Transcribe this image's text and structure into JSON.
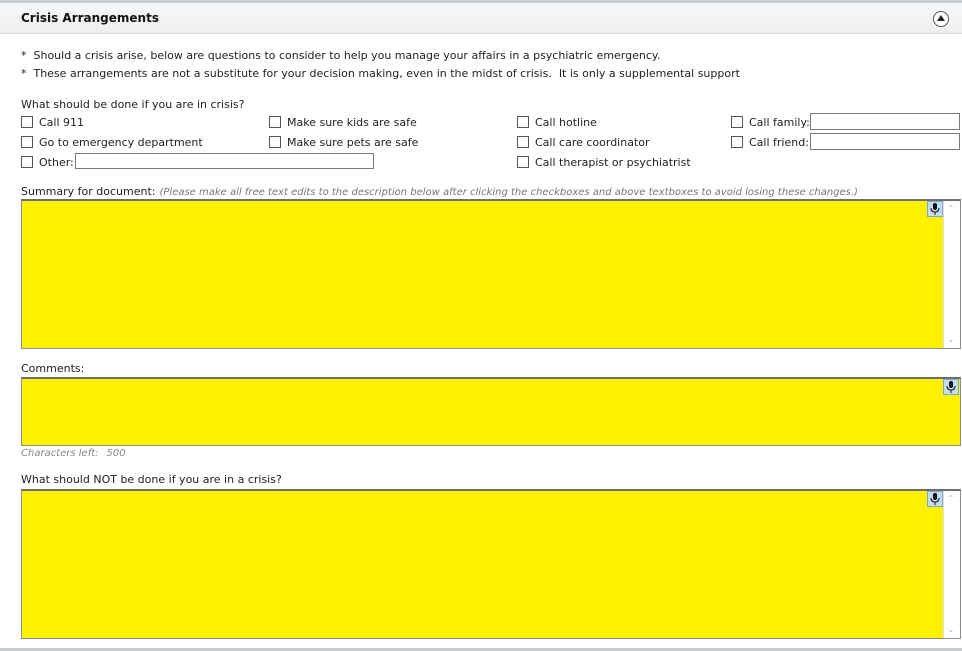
{
  "panel": {
    "title": "Crisis Arrangements"
  },
  "notes": [
    "*  Should a crisis arise, below are questions to consider to help you manage your affairs in a psychiatric emergency.",
    "*  These arrangements are not a substitute for your decision making, even in the midst of crisis.  It is only a supplemental support"
  ],
  "crisis_question": "What should be done if you are in crisis?",
  "options": {
    "call_911": "Call 911",
    "emergency_dept": "Go to emergency department",
    "other": "Other:",
    "kids_safe": "Make sure kids are safe",
    "pets_safe": "Make sure pets are safe",
    "hotline": "Call hotline",
    "care_coordinator": "Call care coordinator",
    "therapist": "Call therapist or psychiatrist",
    "family": "Call family:",
    "friend": "Call friend:"
  },
  "summary": {
    "label": "Summary for document:",
    "hint": "(Please make all free text edits to the description below after clicking the checkboxes and above textboxes to avoid losing these changes.)"
  },
  "comments": {
    "label": "Comments:",
    "chars_left_label": "Characters left:",
    "chars_left_value": "500"
  },
  "not_done": {
    "label": "What should NOT be done if you are in a crisis?"
  },
  "colors": {
    "field_highlight": "#fff200",
    "header_bg": "#eceef0"
  },
  "icons": [
    "collapse-up-icon",
    "microphone-icon"
  ]
}
